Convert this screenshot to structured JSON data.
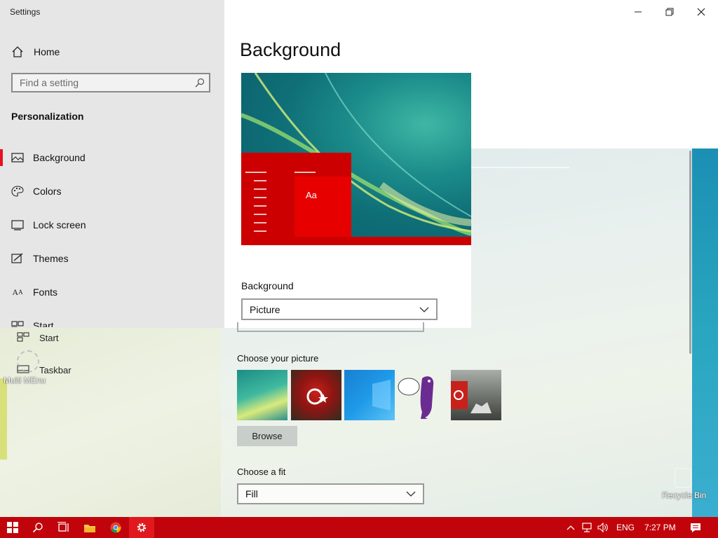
{
  "window": {
    "title": "Settings"
  },
  "sidebar": {
    "home_label": "Home",
    "search_placeholder": "Find a setting",
    "section": "Personalization",
    "items": [
      {
        "label": "Background",
        "icon": "picture-icon",
        "active": true
      },
      {
        "label": "Colors",
        "icon": "palette-icon"
      },
      {
        "label": "Lock screen",
        "icon": "lock-screen-icon"
      },
      {
        "label": "Themes",
        "icon": "themes-icon"
      },
      {
        "label": "Fonts",
        "icon": "fonts-icon"
      },
      {
        "label": "Start",
        "icon": "start-icon"
      }
    ]
  },
  "ghost_sidebar": {
    "items": [
      {
        "label": "Start",
        "icon": "start-icon"
      },
      {
        "label": "Taskbar",
        "icon": "taskbar-icon"
      }
    ]
  },
  "main": {
    "page_title": "Background",
    "preview_text": "Aa",
    "background_label": "Background",
    "background_value": "Picture",
    "choose_picture_label": "Choose your picture",
    "browse_label": "Browse",
    "fit_label": "Choose a fit",
    "fit_value": "Fill"
  },
  "desktop": {
    "icon_left_label": "Multi MEnu",
    "icon_right_label": "Recycle Bin"
  },
  "taskbar": {
    "language": "ENG",
    "time": "7:27 PM"
  },
  "colors": {
    "accent": "#e81123",
    "taskbar": "#c1040b",
    "preview_red": "#cc0000"
  }
}
